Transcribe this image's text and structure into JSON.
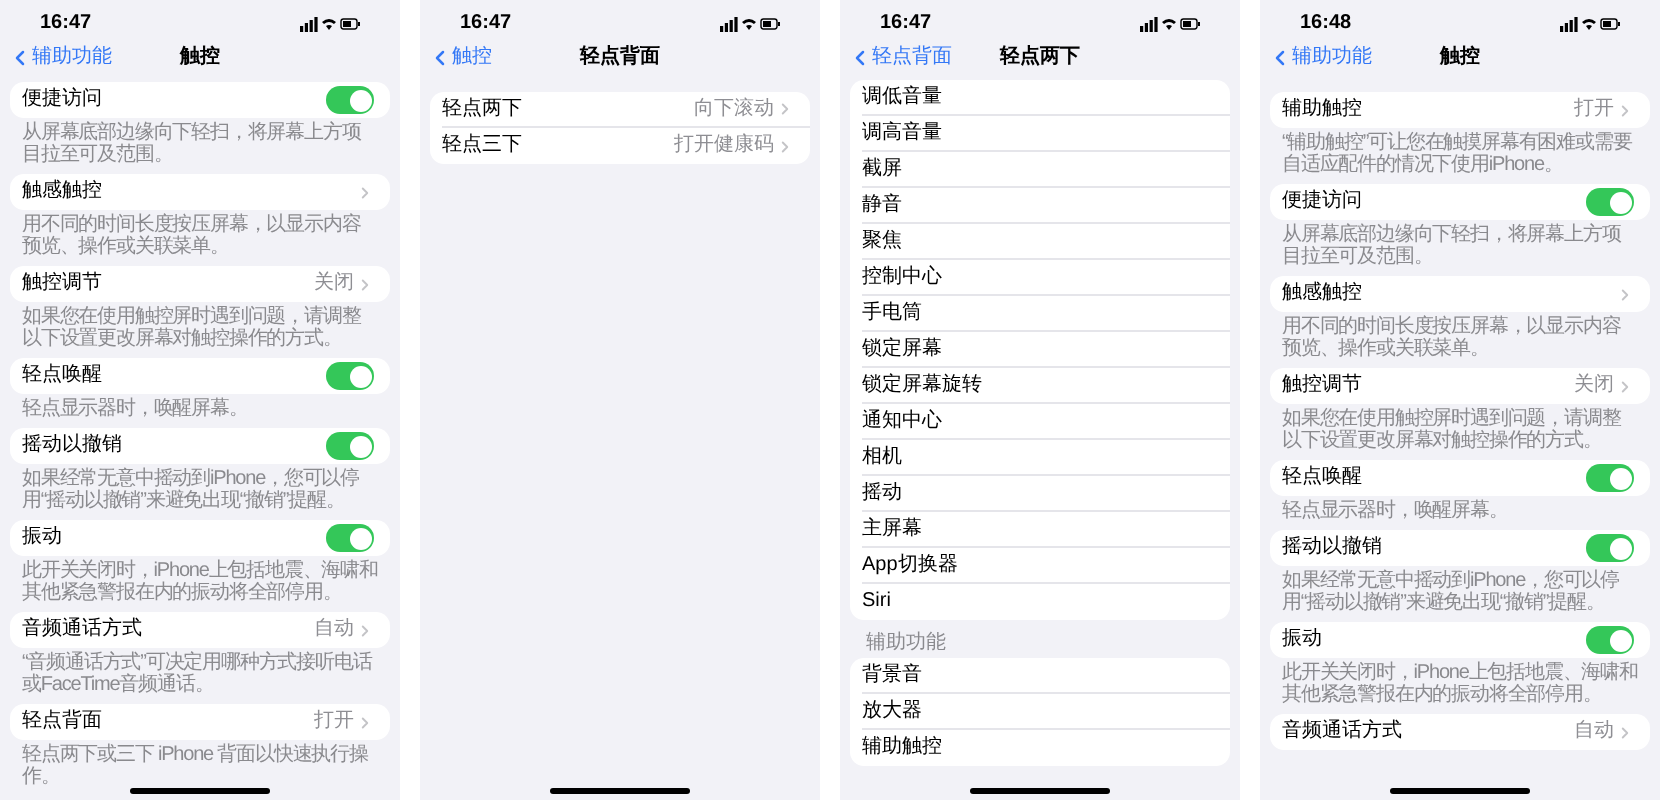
{
  "screens": [
    {
      "time": "16:47",
      "back": "辅助功能",
      "title": "触控",
      "groups": [
        {
          "rows": [
            {
              "kind": "toggle",
              "title": "便捷访问",
              "on": true
            }
          ],
          "footer": "从屏幕底部边缘向下轻扫，将屏幕上方项目拉至可及范围。"
        },
        {
          "rows": [
            {
              "kind": "link",
              "title": "触感触控"
            }
          ],
          "footer": "用不同的时间长度按压屏幕，以显示内容预览、操作或关联菜单。"
        },
        {
          "rows": [
            {
              "kind": "link",
              "title": "触控调节",
              "value": "关闭"
            }
          ],
          "footer": "如果您在使用触控屏时遇到问题，请调整以下设置更改屏幕对触控操作的方式。"
        },
        {
          "rows": [
            {
              "kind": "toggle",
              "title": "轻点唤醒",
              "on": true
            }
          ],
          "footer": "轻点显示器时，唤醒屏幕。"
        },
        {
          "rows": [
            {
              "kind": "toggle",
              "title": "摇动以撤销",
              "on": true
            }
          ],
          "footer": "如果经常无意中摇动到iPhone，您可以停用“摇动以撤销”来避免出现“撤销”提醒。"
        },
        {
          "rows": [
            {
              "kind": "toggle",
              "title": "振动",
              "on": true
            }
          ],
          "footer": "此开关关闭时，iPhone上包括地震、海啸和其他紧急警报在内的振动将全部停用。"
        },
        {
          "rows": [
            {
              "kind": "link",
              "title": "音频通话方式",
              "value": "自动"
            }
          ],
          "footer": "“音频通话方式”可决定用哪种方式接听电话或FaceTime音频通话。"
        },
        {
          "rows": [
            {
              "kind": "link",
              "title": "轻点背面",
              "value": "打开"
            }
          ],
          "footer": "轻点两下或三下 iPhone 背面以快速执行操作。"
        }
      ]
    },
    {
      "time": "16:47",
      "back": "触控",
      "title": "轻点背面",
      "groups": [
        {
          "rows": [
            {
              "kind": "link",
              "title": "轻点两下",
              "value": "向下滚动"
            },
            {
              "kind": "link",
              "title": "轻点三下",
              "value": "打开健康码"
            }
          ]
        }
      ]
    },
    {
      "time": "16:47",
      "back": "轻点背面",
      "title": "轻点两下",
      "groups": [
        {
          "rows": [
            {
              "kind": "plain",
              "title": "调低音量"
            },
            {
              "kind": "plain",
              "title": "调高音量"
            },
            {
              "kind": "plain",
              "title": "截屏"
            },
            {
              "kind": "plain",
              "title": "静音"
            },
            {
              "kind": "plain",
              "title": "聚焦"
            },
            {
              "kind": "plain",
              "title": "控制中心"
            },
            {
              "kind": "plain",
              "title": "手电筒"
            },
            {
              "kind": "plain",
              "title": "锁定屏幕"
            },
            {
              "kind": "plain",
              "title": "锁定屏幕旋转"
            },
            {
              "kind": "plain",
              "title": "通知中心"
            },
            {
              "kind": "plain",
              "title": "相机"
            },
            {
              "kind": "plain",
              "title": "摇动"
            },
            {
              "kind": "plain",
              "title": "主屏幕"
            },
            {
              "kind": "plain",
              "title": "App切换器"
            },
            {
              "kind": "plain",
              "title": "Siri"
            }
          ]
        },
        {
          "header": "辅助功能",
          "rows": [
            {
              "kind": "plain",
              "title": "背景音"
            },
            {
              "kind": "plain",
              "title": "放大器"
            },
            {
              "kind": "plain",
              "title": "辅助触控"
            }
          ]
        }
      ]
    },
    {
      "time": "16:48",
      "back": "辅助功能",
      "title": "触控",
      "groups": [
        {
          "rows": [
            {
              "kind": "link",
              "title": "辅助触控",
              "value": "打开"
            }
          ],
          "footer": "“辅助触控”可让您在触摸屏幕有困难或需要自适应配件的情况下使用iPhone。"
        },
        {
          "rows": [
            {
              "kind": "toggle",
              "title": "便捷访问",
              "on": true
            }
          ],
          "footer": "从屏幕底部边缘向下轻扫，将屏幕上方项目拉至可及范围。"
        },
        {
          "rows": [
            {
              "kind": "link",
              "title": "触感触控"
            }
          ],
          "footer": "用不同的时间长度按压屏幕，以显示内容预览、操作或关联菜单。"
        },
        {
          "rows": [
            {
              "kind": "link",
              "title": "触控调节",
              "value": "关闭"
            }
          ],
          "footer": "如果您在使用触控屏时遇到问题，请调整以下设置更改屏幕对触控操作的方式。"
        },
        {
          "rows": [
            {
              "kind": "toggle",
              "title": "轻点唤醒",
              "on": true
            }
          ],
          "footer": "轻点显示器时，唤醒屏幕。"
        },
        {
          "rows": [
            {
              "kind": "toggle",
              "title": "摇动以撤销",
              "on": true
            }
          ],
          "footer": "如果经常无意中摇动到iPhone，您可以停用“摇动以撤销”来避免出现“撤销”提醒。"
        },
        {
          "rows": [
            {
              "kind": "toggle",
              "title": "振动",
              "on": true
            }
          ],
          "footer": "此开关关闭时，iPhone上包括地震、海啸和其他紧急警报在内的振动将全部停用。"
        },
        {
          "rows": [
            {
              "kind": "link",
              "title": "音频通话方式",
              "value": "自动"
            }
          ]
        }
      ]
    }
  ]
}
